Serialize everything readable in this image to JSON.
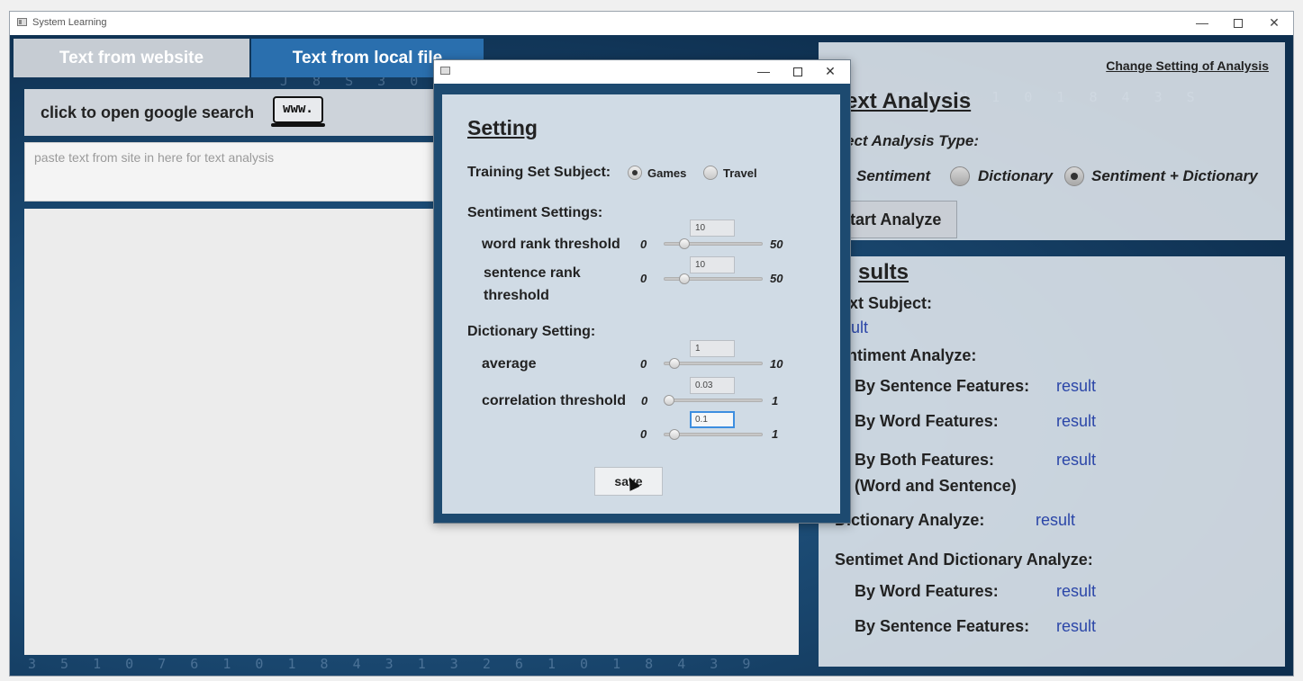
{
  "window": {
    "title": "System Learning"
  },
  "tabs": [
    {
      "label": "Text from website"
    },
    {
      "label": "Text from local file"
    }
  ],
  "website_panel": {
    "google_label": "click to open google search",
    "www_icon_text": "www.",
    "paste_placeholder": "paste text from site in here for text analysis",
    "text_area_value": ""
  },
  "analysis": {
    "change_setting_link": "Change Setting of Analysis",
    "title": "ext Analysis",
    "select_type_label": "ect Analysis Type:",
    "options": [
      {
        "label": "Sentiment",
        "selected": false
      },
      {
        "label": "Dictionary",
        "selected": false
      },
      {
        "label": "Sentiment + Dictionary",
        "selected": true
      }
    ],
    "start_button": "tart Analyze"
  },
  "results": {
    "title": "sults",
    "text_subject_label": "xt Subject:",
    "text_subject_value": "ult",
    "sentiment_label": "ntiment Analyze:",
    "by_sentence_label": "By Sentence Features:",
    "by_sentence_value": "result",
    "by_word_label": "By Word Features:",
    "by_word_value": "result",
    "by_both_label": "By Both Features:",
    "by_both_sub": "(Word and Sentence)",
    "by_both_value": "result",
    "dictionary_label": "Dictionary Analyze:",
    "dictionary_value": "result",
    "sd_label": "Sentimet And Dictionary Analyze:",
    "sd_word_label": "By Word Features:",
    "sd_word_value": "result",
    "sd_sentence_label": "By Sentence Features:",
    "sd_sentence_value": "result"
  },
  "dialog": {
    "title": "Setting",
    "training_label": "Training Set Subject:",
    "training_options": [
      {
        "label": "Games",
        "selected": true
      },
      {
        "label": "Travel",
        "selected": false
      }
    ],
    "sentiment_settings_label": "Sentiment Settings:",
    "word_rank_label": "word rank threshold",
    "word_rank": {
      "min": "0",
      "max": "50",
      "value": "10"
    },
    "sentence_rank_label_1": "sentence rank",
    "sentence_rank_label_2": "threshold",
    "sentence_rank": {
      "min": "0",
      "max": "50",
      "value": "10"
    },
    "dictionary_setting_label": "Dictionary Setting:",
    "average_label": "average",
    "average": {
      "min": "0",
      "max": "10",
      "value": "1"
    },
    "correlation_label": "correlation threshold",
    "correlation": {
      "min": "0",
      "max": "1",
      "value": "0.03"
    },
    "extra": {
      "min": "0",
      "max": "1",
      "value": "0.1"
    },
    "save_button": "save"
  }
}
